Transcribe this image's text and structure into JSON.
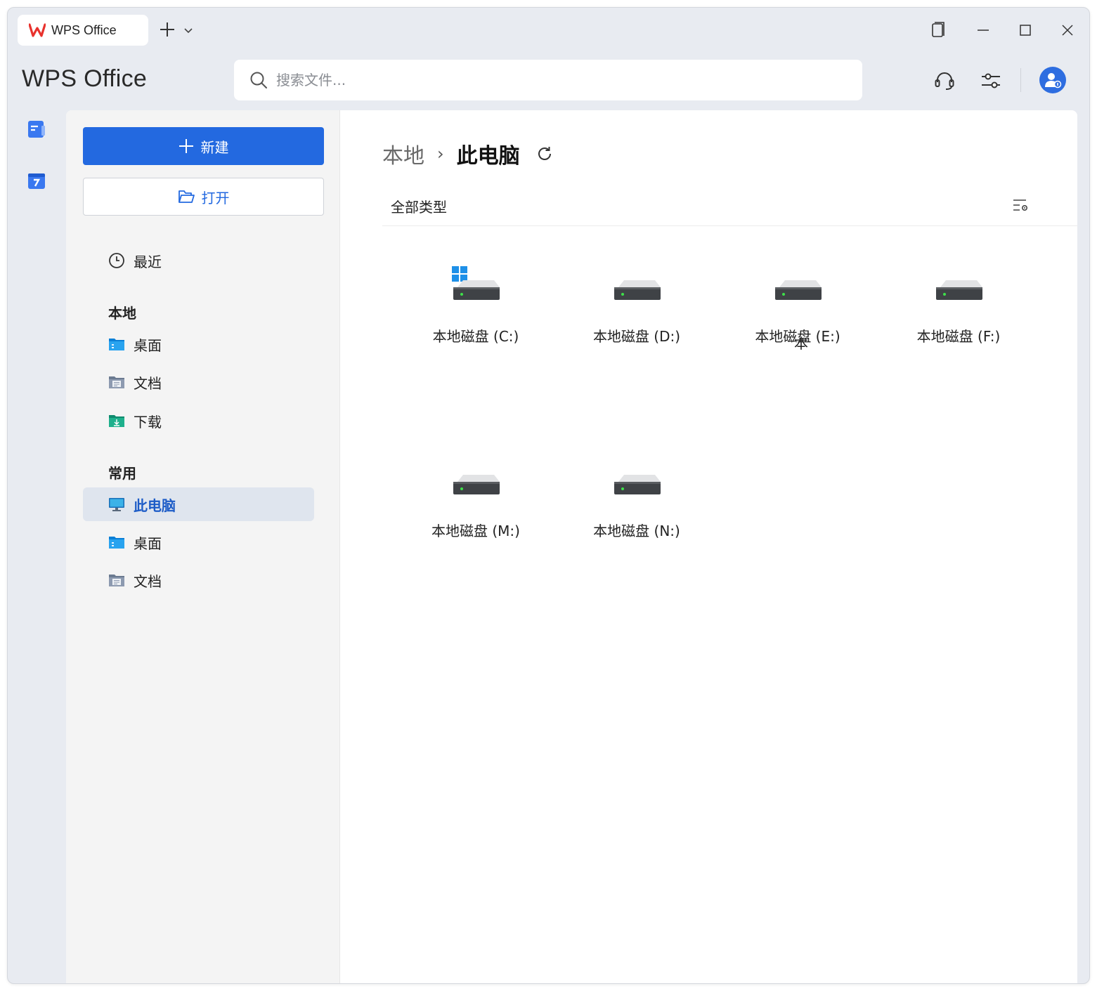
{
  "window": {
    "tab_title": "WPS Office",
    "brand": "WPS Office"
  },
  "search": {
    "placeholder": "搜索文件..."
  },
  "sidebar": {
    "new_label": "新建",
    "open_label": "打开",
    "recent_label": "最近",
    "local_heading": "本地",
    "local_items": [
      {
        "label": "桌面",
        "icon": "desktop-folder-icon"
      },
      {
        "label": "文档",
        "icon": "documents-folder-icon"
      },
      {
        "label": "下载",
        "icon": "downloads-folder-icon"
      }
    ],
    "common_heading": "常用",
    "common_items": [
      {
        "label": "此电脑",
        "icon": "computer-icon",
        "active": true
      },
      {
        "label": "桌面",
        "icon": "desktop-folder-icon"
      },
      {
        "label": "文档",
        "icon": "documents-folder-icon"
      }
    ]
  },
  "content": {
    "breadcrumb_root": "本地",
    "breadcrumb_sep": "›",
    "breadcrumb_current": "此电脑",
    "filter_label": "全部类型",
    "drives": [
      {
        "label": "本地磁盘 (C:)",
        "system": true
      },
      {
        "label": "本地磁盘 (D:)"
      },
      {
        "label": "本地磁盘 (E:)"
      },
      {
        "label": "本地磁盘 (F:)"
      },
      {
        "label": "本地磁盘 (M:)"
      },
      {
        "label": "本地磁盘 (N:)"
      }
    ],
    "partial_drive_label": "本"
  },
  "colors": {
    "accent": "#2369e0",
    "active_bg": "#dfe5ee",
    "sidebar_bg": "#f4f4f4",
    "window_bg": "#e8ebf1"
  }
}
